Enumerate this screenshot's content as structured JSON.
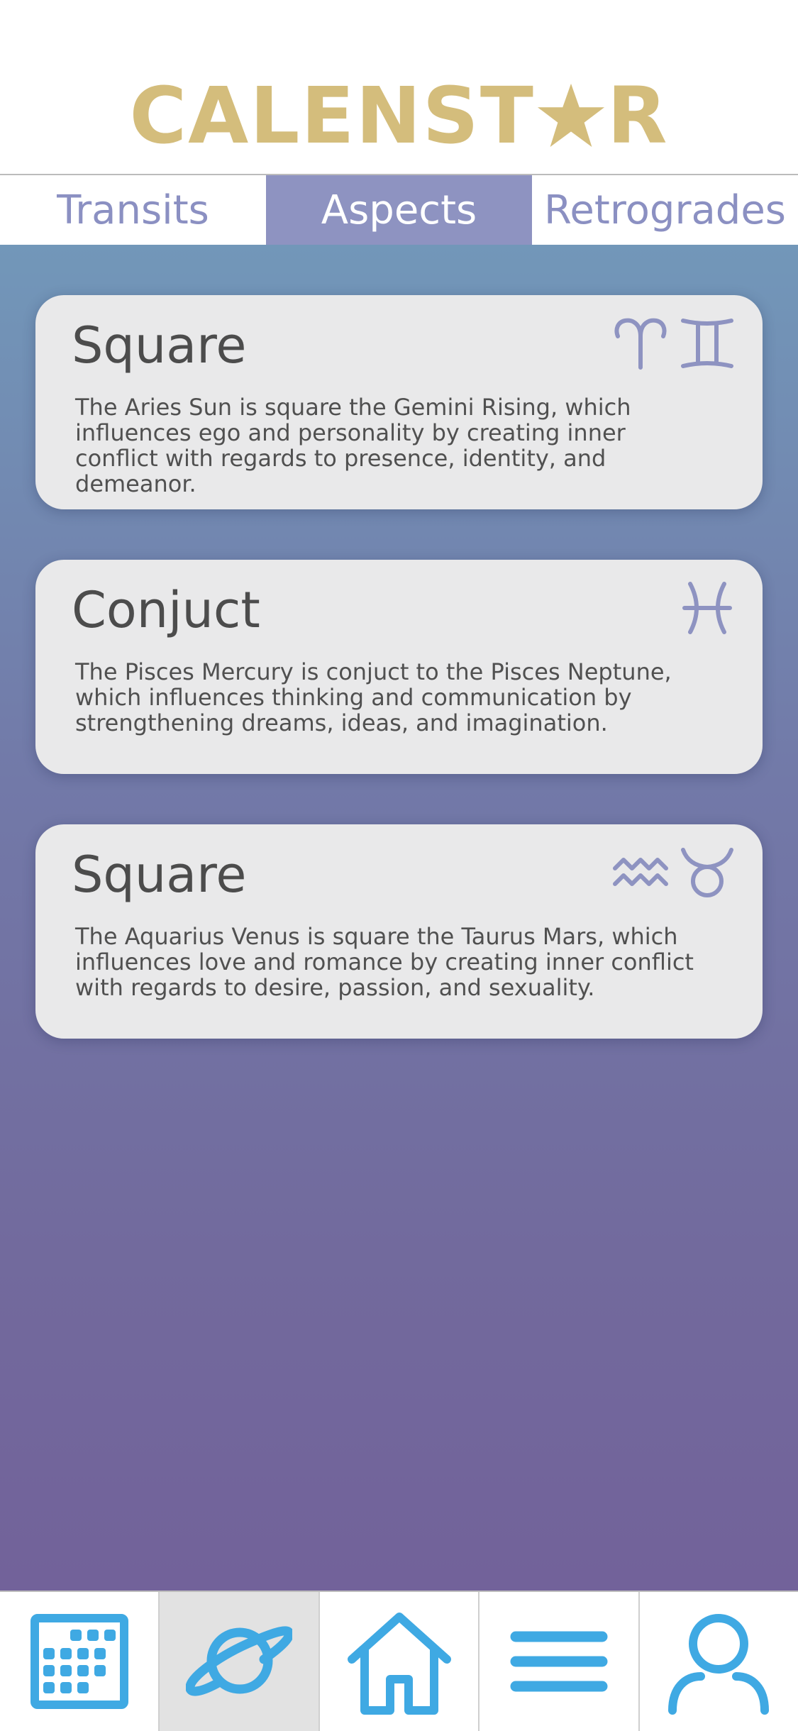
{
  "app": {
    "logo_before_star": "CALENST",
    "logo_after_star": "R",
    "logo_color": "#d4bd7c"
  },
  "tabs": [
    {
      "label": "Transits",
      "active": false
    },
    {
      "label": "Aspects",
      "active": true
    },
    {
      "label": "Retrogrades",
      "active": false
    }
  ],
  "colors": {
    "accent": "#8e93c1",
    "nav_icon": "#3fa9e3",
    "card_bg": "#e9e9ea"
  },
  "cards": [
    {
      "title": "Square",
      "description": "The Aries Sun is square the Gemini Rising, which influences ego and personality by creating inner conflict with regards to presence, identity, and demeanor.",
      "icons": [
        "aries-icon",
        "gemini-icon"
      ]
    },
    {
      "title": "Conjuct",
      "description": "The Pisces Mercury is conjuct to the Pisces Neptune, which influences thinking and communication by strengthening dreams, ideas, and imagination.",
      "icons": [
        "pisces-icon"
      ]
    },
    {
      "title": "Square",
      "description": "The Aquarius Venus is square the Taurus Mars, which influences love and romance by creating inner conflict with regards to desire, passion, and sexuality.",
      "icons": [
        "aquarius-icon",
        "taurus-icon"
      ]
    }
  ],
  "bottom_nav": [
    {
      "icon": "calendar-icon",
      "active": false
    },
    {
      "icon": "planet-icon",
      "active": true
    },
    {
      "icon": "home-icon",
      "active": false
    },
    {
      "icon": "menu-icon",
      "active": false
    },
    {
      "icon": "profile-icon",
      "active": false
    }
  ]
}
